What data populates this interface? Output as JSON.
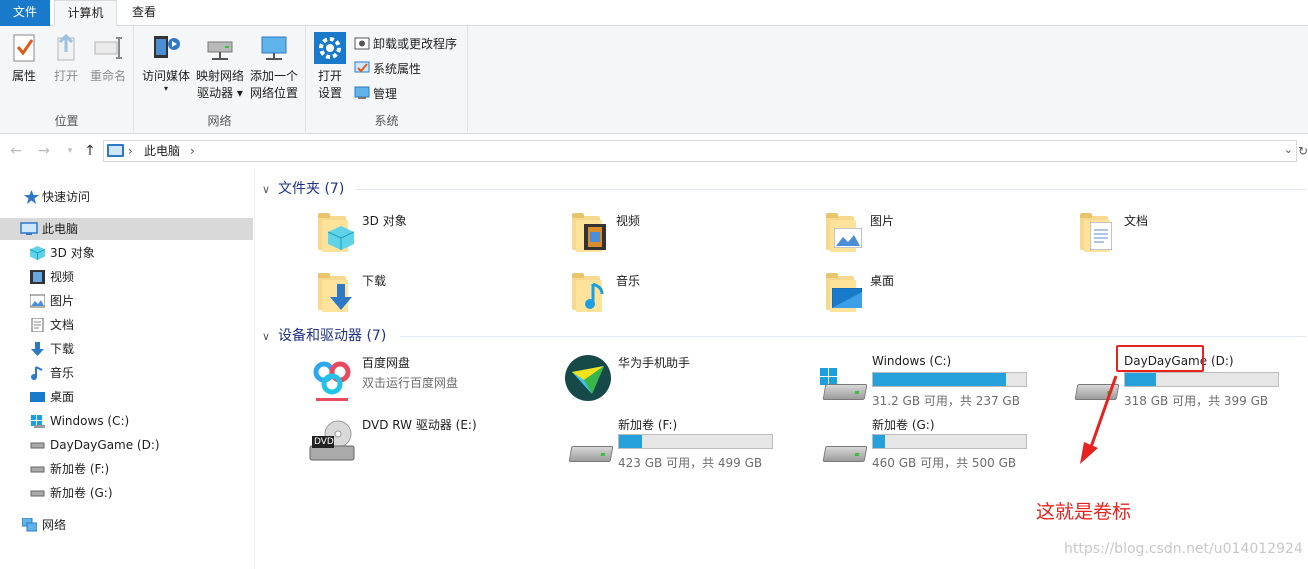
{
  "ribbon": {
    "tabs": [
      "文件",
      "计算机",
      "查看"
    ],
    "groups": {
      "location": {
        "label": "位置",
        "properties": "属性",
        "open": "打开",
        "rename": "重命名"
      },
      "network": {
        "label": "网络",
        "access_media": "访问媒体",
        "map_drive_1": "映射网络",
        "map_drive_2": "驱动器",
        "add_location_1": "添加一个",
        "add_location_2": "网络位置"
      },
      "system": {
        "label": "系统",
        "open_settings_1": "打开",
        "open_settings_2": "设置",
        "uninstall": "卸载或更改程序",
        "system_properties": "系统属性",
        "manage": "管理"
      }
    }
  },
  "address": {
    "crumb": "此电脑"
  },
  "sidebar": {
    "quick_access": "快速访问",
    "this_pc": "此电脑",
    "items": [
      "3D 对象",
      "视频",
      "图片",
      "文档",
      "下载",
      "音乐",
      "桌面",
      "Windows (C:)",
      "DayDayGame (D:)",
      "新加卷 (F:)",
      "新加卷 (G:)"
    ],
    "network": "网络"
  },
  "folders_section": {
    "title": "文件夹 (7)",
    "items": [
      "3D 对象",
      "视频",
      "图片",
      "文档",
      "下载",
      "音乐",
      "桌面"
    ]
  },
  "devices_section": {
    "title": "设备和驱动器 (7)",
    "baidu": {
      "name": "百度网盘",
      "sub": "双击运行百度网盘"
    },
    "huawei": {
      "name": "华为手机助手"
    },
    "drive_c": {
      "name": "Windows (C:)",
      "size": "31.2 GB 可用，共 237 GB",
      "used_fraction": 0.87
    },
    "drive_d": {
      "name_label": "DayDayGame",
      "name_letter": " (D:)",
      "size": "318 GB 可用，共 399 GB",
      "used_fraction": 0.2
    },
    "dvd": {
      "name": "DVD RW 驱动器 (E:)",
      "badge": "DVD"
    },
    "drive_f": {
      "name": "新加卷 (F:)",
      "size": "423 GB 可用，共 499 GB",
      "used_fraction": 0.15
    },
    "drive_g": {
      "name": "新加卷 (G:)",
      "size": "460 GB 可用，共 500 GB",
      "used_fraction": 0.08
    }
  },
  "annotation": {
    "text": "这就是卷标",
    "color": "#e8231f"
  },
  "watermark": "https://blog.csdn.net/u014012924"
}
